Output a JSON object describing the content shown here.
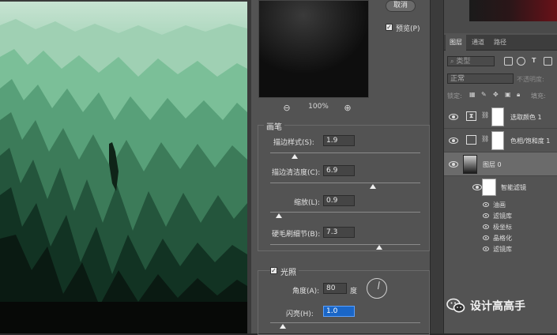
{
  "dialog": {
    "cancel_label": "取消",
    "preview_label": "预览(P)",
    "preview_checked": true,
    "zoom": "100%",
    "brush_group": {
      "title": "画笔",
      "params": [
        {
          "label": "描边样式(S):",
          "value": "1.9",
          "level": 0.08
        },
        {
          "label": "描边清洁度(C):",
          "value": "6.9",
          "level": 0.69
        },
        {
          "label": "缩放(L):",
          "value": "0.9",
          "level": 0.05
        },
        {
          "label": "硬毛刷细节(B):",
          "value": "7.3",
          "level": 0.73
        }
      ]
    },
    "lighting_group": {
      "title": "光照",
      "checked": true,
      "angle_label": "角度(A):",
      "angle_value": "80",
      "angle_unit": "度",
      "shine_label": "闪亮(H):",
      "shine_value": "1.0",
      "shine_level": 0.1
    }
  },
  "layers_panel": {
    "tabs": [
      "图层",
      "通道",
      "路径"
    ],
    "active_tab": "图层",
    "filter_placeholder": "类型",
    "blend_mode": "正常",
    "opacity_label": "不透明度:",
    "lock_label": "锁定:",
    "fill_label": "填充:",
    "layers": [
      {
        "name": "选取颜色 1",
        "icon": "selective-color-icon",
        "visible": true
      },
      {
        "name": "色相/饱和度 1",
        "icon": "hue-saturation-icon",
        "visible": true
      },
      {
        "name": "图层 0",
        "icon": "smart-object-icon",
        "visible": true,
        "selected": true
      }
    ],
    "smart_filters_label": "智能滤镜",
    "filters": [
      "油画",
      "滤镜库",
      "极坐标",
      "晶格化",
      "滤镜库"
    ]
  },
  "watermark": {
    "text": "设计高高手",
    "icon": "wechat-icon"
  },
  "colors": {
    "accent_field": "#1a66c7",
    "panel_bg": "#535353",
    "canvas_green": "#5fa47a"
  }
}
